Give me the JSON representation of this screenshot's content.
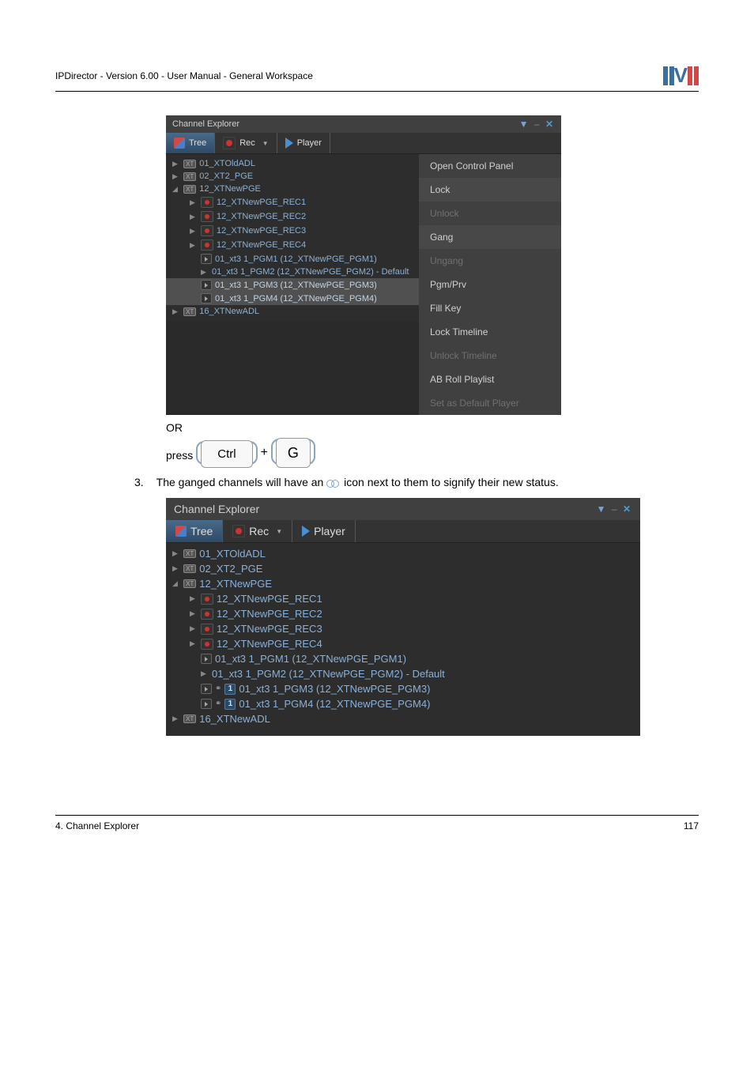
{
  "header": {
    "title": "IPDirector - Version 6.00 - User Manual - General Workspace"
  },
  "panel1": {
    "title": "Channel Explorer",
    "toolbar": {
      "tree": "Tree",
      "rec": "Rec",
      "player": "Player"
    },
    "tree": {
      "n0": "01_XTOldADL",
      "n1": "02_XT2_PGE",
      "n2": "12_XTNewPGE",
      "n2_c0": "12_XTNewPGE_REC1",
      "n2_c1": "12_XTNewPGE_REC2",
      "n2_c2": "12_XTNewPGE_REC3",
      "n2_c3": "12_XTNewPGE_REC4",
      "n2_c4": "01_xt3 1_PGM1 (12_XTNewPGE_PGM1)",
      "n2_c5": "01_xt3 1_PGM2 (12_XTNewPGE_PGM2) - Default",
      "n2_c6": "01_xt3 1_PGM3 (12_XTNewPGE_PGM3)",
      "n2_c7": "01_xt3 1_PGM4 (12_XTNewPGE_PGM4)",
      "n3": "16_XTNewADL"
    },
    "ctx": {
      "open": "Open Control Panel",
      "lock": "Lock",
      "unlock": "Unlock",
      "gang": "Gang",
      "ungang": "Ungang",
      "pgmprv": "Pgm/Prv",
      "fillkey": "Fill Key",
      "locktl": "Lock Timeline",
      "unlocktl": "Unlock Timeline",
      "abroll": "AB Roll Playlist",
      "setdef": "Set as Default Player"
    }
  },
  "or_text": "OR",
  "press_label": "press",
  "key_ctrl": "Ctrl",
  "key_g": "G",
  "plus": "+",
  "step3": {
    "num": "3.",
    "pre": "The ganged channels will have an ",
    "post": " icon next to them to signify their new status."
  },
  "panel2": {
    "title": "Channel Explorer",
    "toolbar": {
      "tree": "Tree",
      "rec": "Rec",
      "player": "Player"
    },
    "tree": {
      "n0": "01_XTOldADL",
      "n1": "02_XT2_PGE",
      "n2": "12_XTNewPGE",
      "n2_c0": "12_XTNewPGE_REC1",
      "n2_c1": "12_XTNewPGE_REC2",
      "n2_c2": "12_XTNewPGE_REC3",
      "n2_c3": "12_XTNewPGE_REC4",
      "n2_c4": "01_xt3 1_PGM1 (12_XTNewPGE_PGM1)",
      "n2_c5": "01_xt3 1_PGM2 (12_XTNewPGE_PGM2) - Default",
      "n2_c6": "01_xt3 1_PGM3 (12_XTNewPGE_PGM3)",
      "n2_c7": "01_xt3 1_PGM4 (12_XTNewPGE_PGM4)",
      "n3": "16_XTNewADL"
    }
  },
  "footer": {
    "left": "4. Channel Explorer",
    "right": "117"
  }
}
